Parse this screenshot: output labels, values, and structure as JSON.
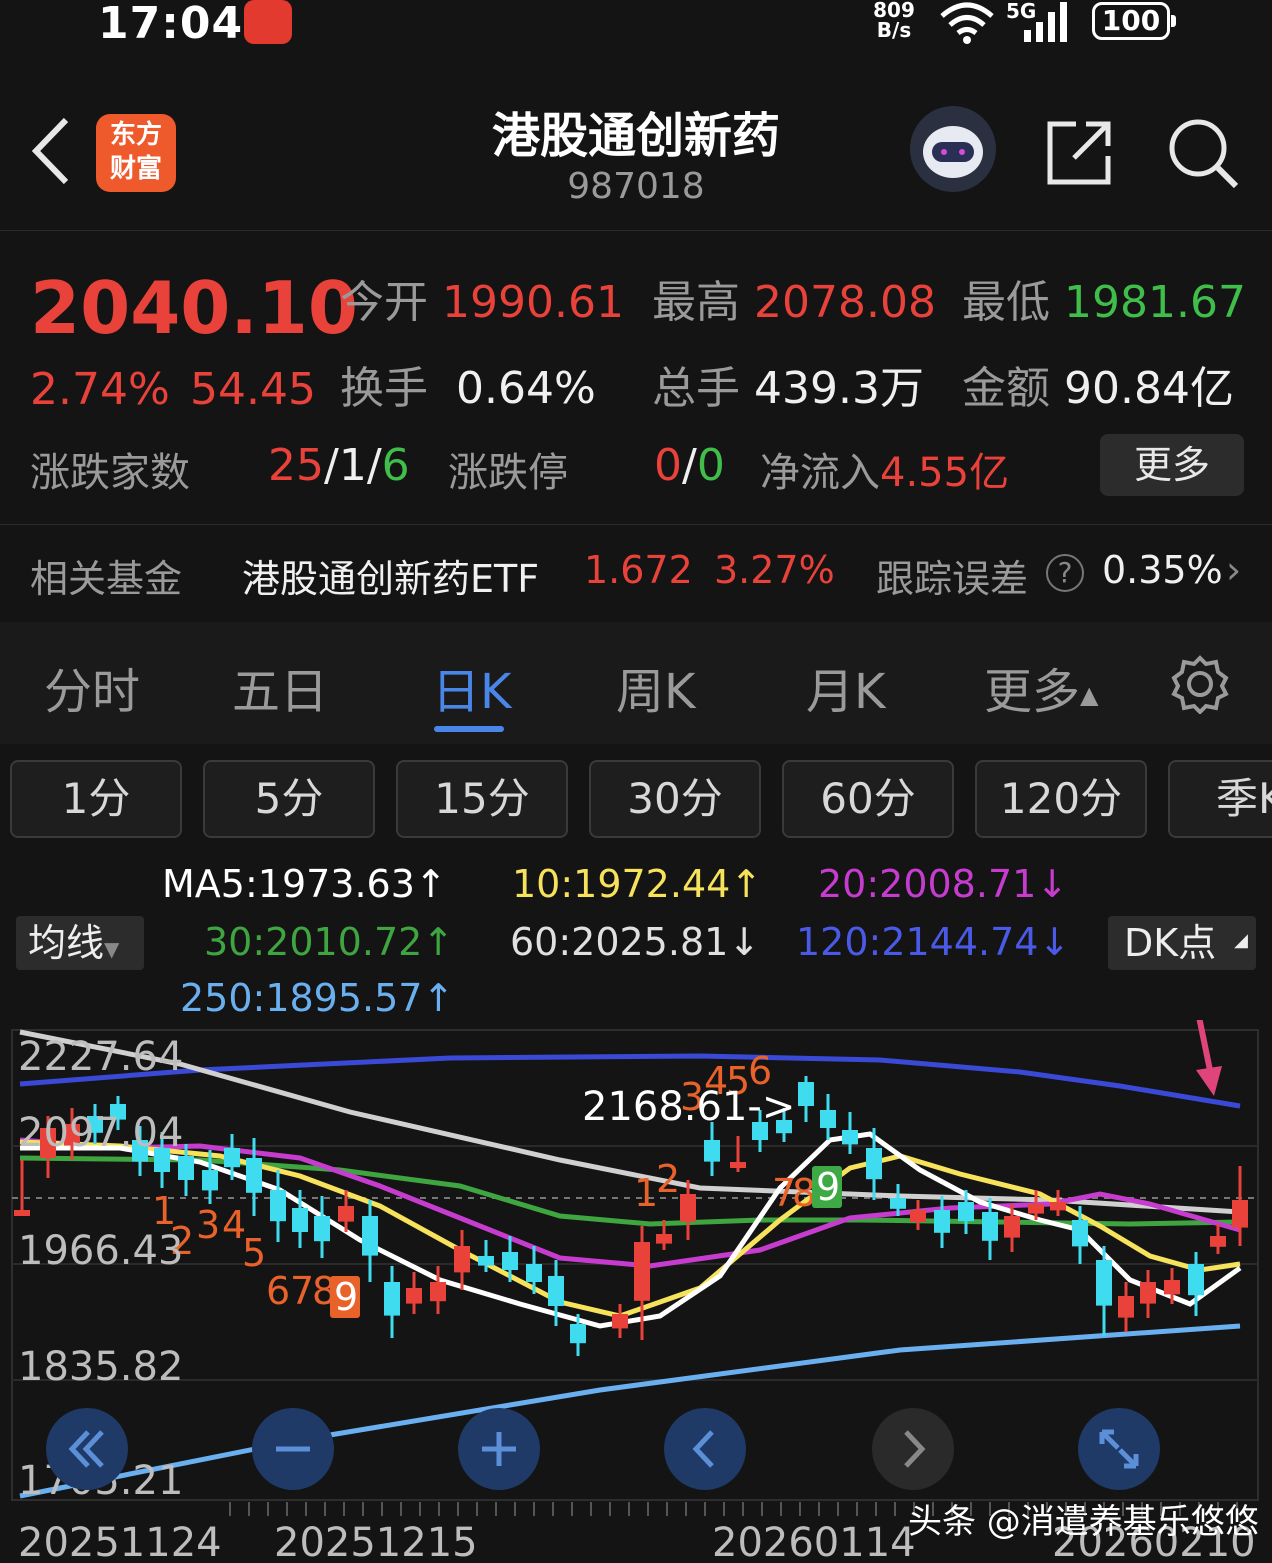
{
  "status": {
    "time": "17:04",
    "net_speed": "809 B/s",
    "network": "5G",
    "battery": "100"
  },
  "header": {
    "logo_text": "东方财富",
    "title": "港股通创新药",
    "code": "987018"
  },
  "quote": {
    "price": "2040.10",
    "change_pct": "2.74%",
    "change": "54.45",
    "open_label": "今开",
    "open": "1990.61",
    "high_label": "最高",
    "high": "2078.08",
    "low_label": "最低",
    "low": "1981.67",
    "turnover_label": "换手",
    "turnover": "0.64%",
    "volume_label": "总手",
    "volume": "439.3万",
    "amount_label": "金额",
    "amount": "90.84亿",
    "breadth_label": "涨跌家数",
    "breadth_up": "25",
    "breadth_flat": "1",
    "breadth_down": "6",
    "limit_label": "涨跌停",
    "limit_up": "0",
    "limit_down": "0",
    "netflow_label": "净流入",
    "netflow": "4.55亿",
    "more_label": "更多"
  },
  "fund": {
    "label": "相关基金",
    "name": "港股通创新药ETF",
    "price": "1.672",
    "pct": "3.27%",
    "track_label": "跟踪误差",
    "track": "0.35%"
  },
  "tabs": [
    "分时",
    "五日",
    "日K",
    "周K",
    "月K",
    "更多"
  ],
  "active_tab": "日K",
  "periods": [
    "1分",
    "5分",
    "15分",
    "30分",
    "60分",
    "120分",
    "季K"
  ],
  "ma": {
    "selector": "均线",
    "ma5": "MA5:1973.63↑",
    "ma10": "10:1972.44↑",
    "ma20": "20:2008.71↓",
    "ma30": "30:2010.72↑",
    "ma60": "60:2025.81↓",
    "ma120": "120:2144.74↓",
    "ma250": "250:1895.57↑",
    "dk": "DK点"
  },
  "colors": {
    "up": "#e8423a",
    "down": "#3fdcf0",
    "ma5": "#ffffff",
    "ma10": "#f7e25c",
    "ma20": "#c63ccf",
    "ma30": "#3fa540",
    "ma60": "#d0d0d0",
    "ma120": "#3a4ad6",
    "ma250": "#6ab0f0"
  },
  "chart": {
    "y_labels": [
      "2227.64",
      "2097.04",
      "1966.43",
      "1835.82",
      "1705.21"
    ],
    "x_labels": [
      "20251124",
      "20251215",
      "20260114",
      "20260210"
    ],
    "peak_label": "2168.61->",
    "watermark": "头条 @消遣养基乐悠悠",
    "seq_down": [
      "1",
      "2",
      "3",
      "4",
      "5",
      "6",
      "7",
      "8",
      "9"
    ],
    "seq_up": [
      "1",
      "2",
      "3",
      "4",
      "5",
      "6",
      "7",
      "8",
      "9"
    ]
  }
}
